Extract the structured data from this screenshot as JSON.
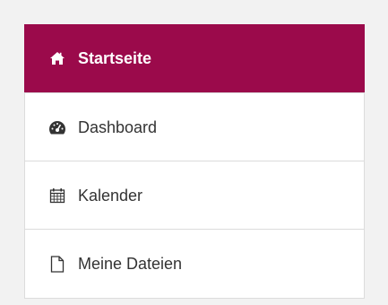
{
  "nav": {
    "items": [
      {
        "label": "Startseite",
        "icon": "home-icon",
        "active": true
      },
      {
        "label": "Dashboard",
        "icon": "dashboard-icon",
        "active": false
      },
      {
        "label": "Kalender",
        "icon": "calendar-icon",
        "active": false
      },
      {
        "label": "Meine Dateien",
        "icon": "file-icon",
        "active": false
      }
    ],
    "active_color": "#9b0a4b",
    "text_color": "#333333"
  }
}
